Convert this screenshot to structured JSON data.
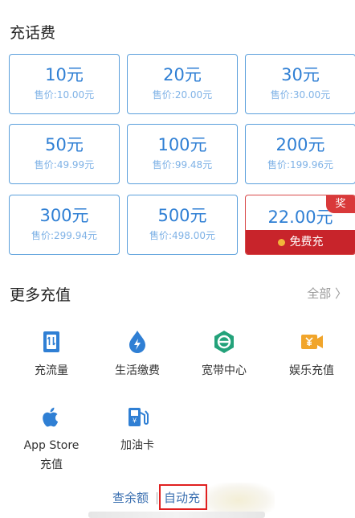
{
  "recharge": {
    "title": "充话费",
    "cards": [
      {
        "amount": "10元",
        "price": "售价:10.00元"
      },
      {
        "amount": "20元",
        "price": "售价:20.00元"
      },
      {
        "amount": "30元",
        "price": "售价:30.00元"
      },
      {
        "amount": "50元",
        "price": "售价:49.99元"
      },
      {
        "amount": "100元",
        "price": "售价:99.48元"
      },
      {
        "amount": "200元",
        "price": "售价:199.96元"
      },
      {
        "amount": "300元",
        "price": "售价:299.94元"
      },
      {
        "amount": "500元",
        "price": "售价:498.00元"
      }
    ],
    "promo": {
      "amount": "22.00元",
      "band": "免费充",
      "badge": "奖"
    }
  },
  "more": {
    "title": "更多充值",
    "all_link": "全部 〉",
    "items": [
      {
        "label": "充流量",
        "icon": "sim-card-icon"
      },
      {
        "label": "生活缴费",
        "icon": "utility-bolt-icon"
      },
      {
        "label": "宽带中心",
        "icon": "broadband-icon"
      },
      {
        "label": "娱乐充值",
        "icon": "video-ticket-icon"
      },
      {
        "label": "App Store",
        "label2": "充值",
        "icon": "apple-icon"
      },
      {
        "label": "加油卡",
        "icon": "fuel-pump-icon"
      }
    ]
  },
  "bottom": {
    "check_balance": "查余额",
    "auto_recharge": "自动充"
  },
  "colors": {
    "card_border": "#5ca0dc",
    "card_text": "#2f7fd4",
    "promo_red": "#c8242b",
    "link_blue": "#3a6fb0",
    "highlight": "#e02020"
  }
}
